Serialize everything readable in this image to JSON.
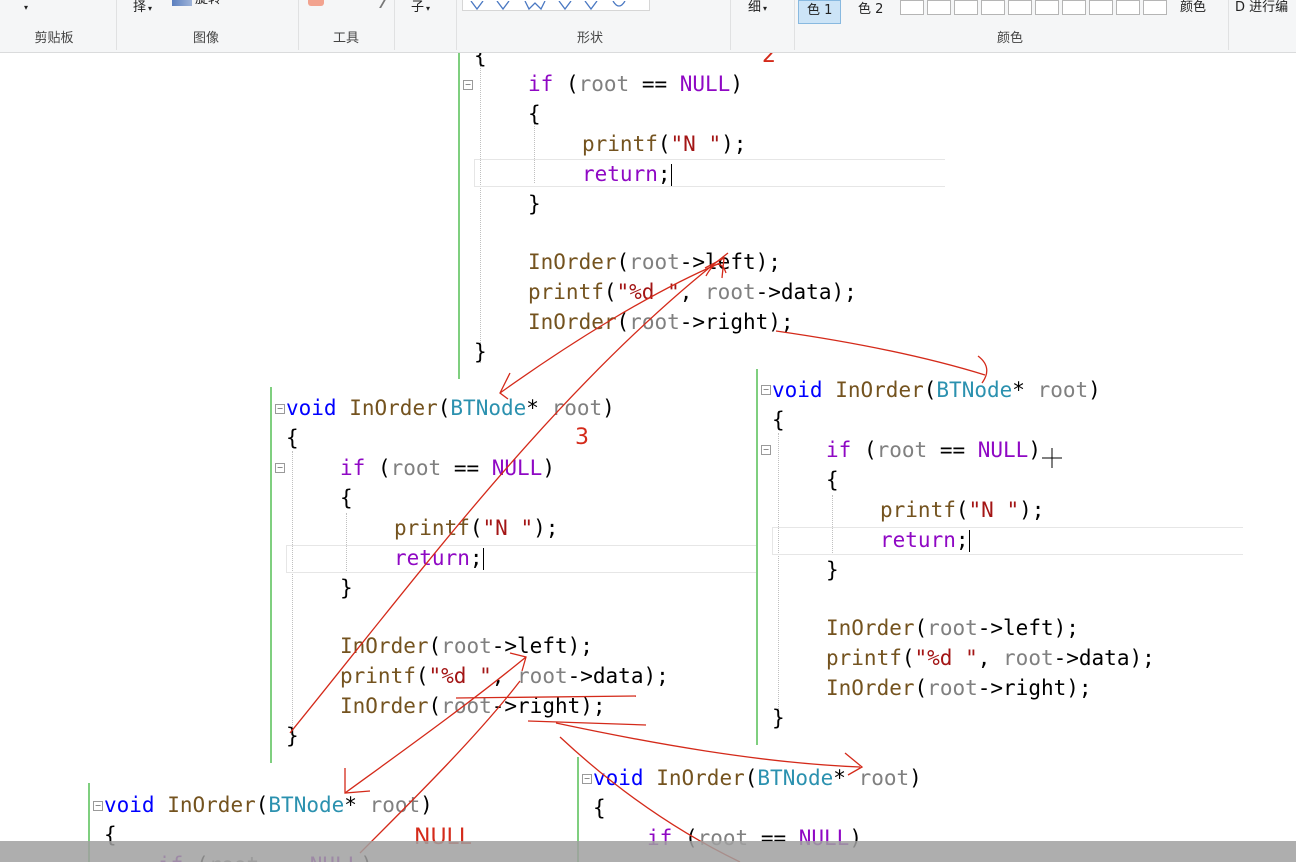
{
  "ribbon": {
    "groups": {
      "clipboard": "剪贴板",
      "image": "图像",
      "tools": "工具",
      "shapes": "形状",
      "colors": "颜色"
    },
    "select_label": "择",
    "rotate_label": "旋转",
    "brush_label": "子",
    "size_label": "细",
    "color1_label": "色 1",
    "color2_label": "色 2",
    "edit_colors_label": "颜色",
    "paint3d_label": "D 进行编"
  },
  "code": {
    "func_header": {
      "kw": "void",
      "name": "InOrder",
      "type": "BTNode",
      "star": "*",
      "param": "root",
      "open": "(",
      "close": ")"
    },
    "open_brace": "{",
    "close_brace": "}",
    "if_kw": "if",
    "if_open": " (",
    "root": "root",
    "eq": " == ",
    "null": "NULL",
    "rparen": ")",
    "printf": "printf",
    "n_str": "\"N \"",
    "stmt_end": ");",
    "return_kw": "return",
    "semi": ";",
    "inorder": "InOrder",
    "lparen": "(",
    "arrow_left": "->left",
    "arrow_right": "->right",
    "fmt_str": "\"%d \"",
    "comma": ", ",
    "arrow_data": "->data"
  },
  "annotations": {
    "num2": "2",
    "num3": "3",
    "null_note": "NULL"
  },
  "colors": {
    "keyword": "#0000ff",
    "control": "#8f08c4",
    "type": "#2b91af",
    "param": "#808080",
    "function": "#74531f",
    "string": "#a31515",
    "ink": "#d42a1a"
  }
}
